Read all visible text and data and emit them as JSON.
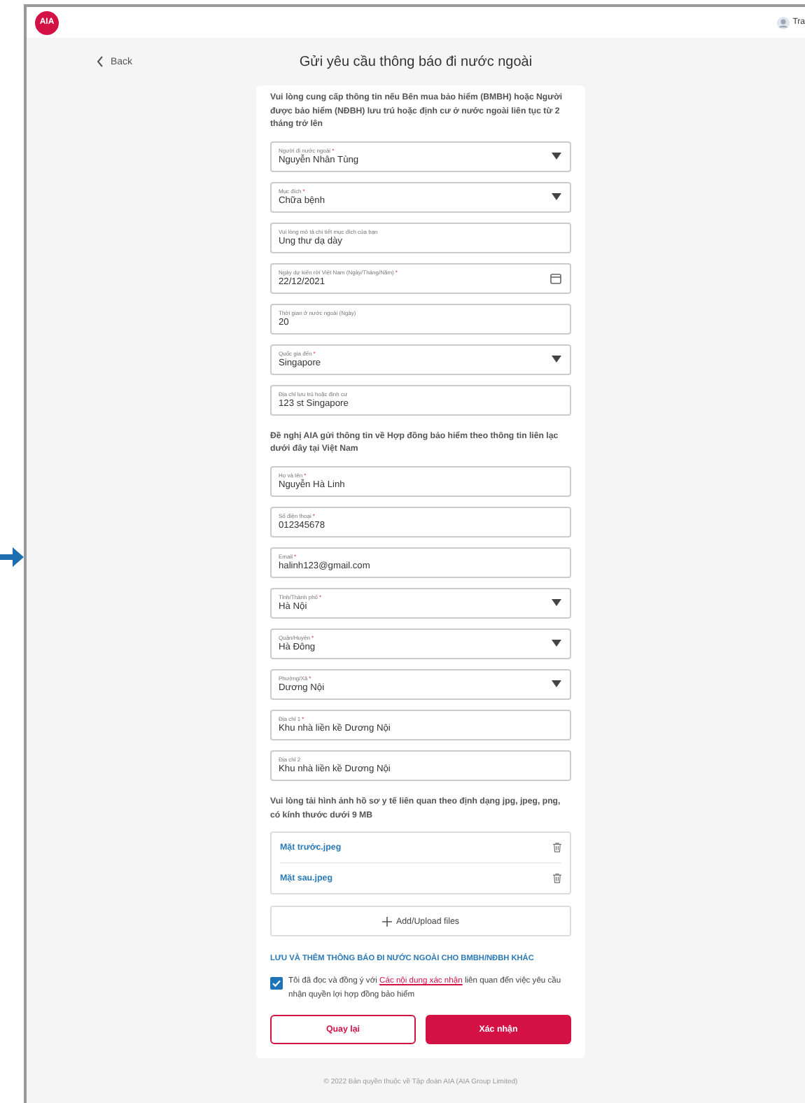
{
  "header": {
    "logo": "AIA",
    "user_name": "Tra"
  },
  "title_bar": {
    "back": "Back",
    "title": "Gửi yêu cầu thông báo đi nước ngoài"
  },
  "intro": "Vui lòng cung cấp thông tin nếu Bên mua bảo hiểm (BMBH) hoặc Người được bảo hiểm (NĐBH) lưu trú hoặc định cư ở nước ngoài liên tục từ 2 tháng trở lên",
  "travel_fields": [
    {
      "kind": "select",
      "label": "Người đi nước ngoài",
      "required_mark": "*",
      "value": "Nguyễn Nhân Tùng"
    },
    {
      "kind": "select",
      "label": "Mục đích",
      "required_mark": "*",
      "value": "Chữa bệnh"
    },
    {
      "kind": "text",
      "label": "Vui lòng mô tả chi tiết mục đích của bạn",
      "value": "Ung thư dạ dày"
    },
    {
      "kind": "date",
      "label": "Ngày dự kiến rời Việt Nam (Ngày/Tháng/Năm)",
      "required_mark": "*",
      "value": "22/12/2021"
    },
    {
      "kind": "text",
      "label": "Thời gian ở nước ngoài (Ngày)",
      "value": "20"
    },
    {
      "kind": "select",
      "label": "Quốc gia đến",
      "required_mark": "*",
      "value": "Singapore"
    },
    {
      "kind": "text",
      "label": "Địa chỉ lưu trú hoặc định cư",
      "value": "123 st Singapore"
    }
  ],
  "contact_intro": "Đề nghị AIA gửi thông tin về Hợp đồng bảo hiểm theo thông tin liên lạc dưới đây tại Việt Nam",
  "contact_fields": [
    {
      "kind": "text",
      "label": "Họ và tên",
      "required_mark": "*",
      "value": "Nguyễn Hà Linh"
    },
    {
      "kind": "text",
      "label": "Số điện thoại",
      "required_mark": "*",
      "value": "012345678"
    },
    {
      "kind": "text",
      "label": "Email",
      "required_mark": "*",
      "value": "halinh123@gmail.com"
    },
    {
      "kind": "select",
      "label": "Tỉnh/Thành phố",
      "required_mark": "*",
      "value": "Hà Nội"
    },
    {
      "kind": "select",
      "label": "Quận/Huyện",
      "required_mark": "*",
      "value": "Hà Đông"
    },
    {
      "kind": "select",
      "label": "Phường/Xã",
      "required_mark": "*",
      "value": "Dương Nội"
    },
    {
      "kind": "text",
      "label": "Địa chỉ 1",
      "required_mark": "*",
      "value": "Khu nhà liền kề Dương Nội"
    },
    {
      "kind": "text",
      "label": "Địa chỉ 2",
      "value": "Khu nhà liền kề Dương Nội"
    }
  ],
  "upload_note": "Vui lòng tải hình ảnh hồ sơ y tế liên quan theo định dạng jpg, jpeg, png, có kính thước dưới 9 MB",
  "files": [
    {
      "name": "Mặt trước.jpeg"
    },
    {
      "name": "Mặt sau.jpeg"
    }
  ],
  "upload_button": "Add/Upload files",
  "save_link": "LƯU VÀ THÊM THÔNG BÁO ĐI NƯỚC NGOÀI CHO BMBH/NĐBH KHÁC",
  "consent": {
    "checked": true,
    "text_before": "Tôi đã đọc và đồng ý với",
    "link": "Các nội dung xác nhận",
    "text_after": "liên quan đến việc yêu cầu nhận quyền lợi hợp đồng bảo hiểm"
  },
  "buttons": {
    "back": "Quay lại",
    "confirm": "Xác nhận"
  },
  "footer": "© 2022 Bản quyền thuộc về Tập đoàn AIA (AIA Group Limited)"
}
